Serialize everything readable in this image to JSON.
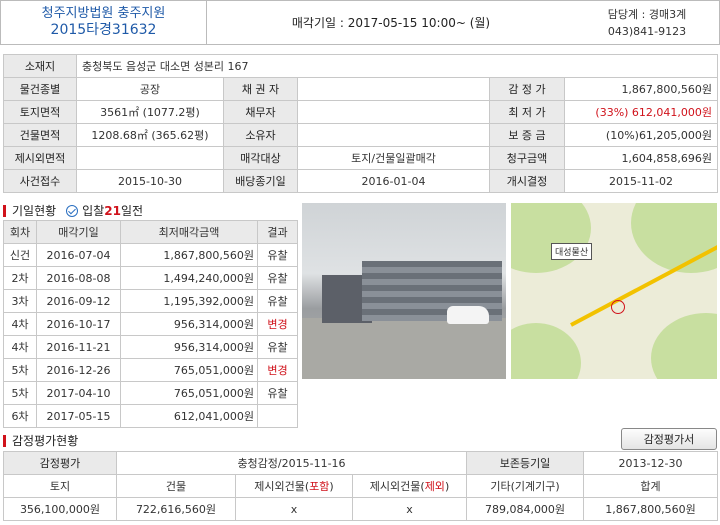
{
  "header": {
    "court": "청주지방법원 충주지원",
    "case_no": "2015타경31632",
    "sale_date": "매각기일 : 2017-05-15  10:00~ (월)",
    "division": "담당계 : 경매3계",
    "phone": "043)841-9123"
  },
  "info": {
    "location_label": "소재지",
    "location": "충청북도 음성군 대소면 성본리 167",
    "rows": [
      [
        "물건종별",
        "공장",
        "채 권 자",
        "",
        "감 정 가",
        "1,867,800,560원"
      ],
      [
        "토지면적",
        "3561㎡ (1077.2평)",
        "채무자",
        "",
        "최 저 가",
        "(33%) 612,041,000원"
      ],
      [
        "건물면적",
        "1208.68㎡ (365.62평)",
        "소유자",
        "",
        "보 증 금",
        "(10%)61,205,000원"
      ],
      [
        "제시외면적",
        "",
        "매각대상",
        "토지/건물일괄매각",
        "청구금액",
        "1,604,858,696원"
      ],
      [
        "사건접수",
        "2015-10-30",
        "배당종기일",
        "2016-01-04",
        "개시결정",
        "2015-11-02"
      ]
    ]
  },
  "history": {
    "title": "기일현황",
    "summary_prefix": "입찰",
    "summary_days": "21",
    "summary_suffix": "일전",
    "headers": [
      "회차",
      "매각기일",
      "최저매각금액",
      "결과"
    ],
    "rows": [
      [
        "신건",
        "2016-07-04",
        "1,867,800,560원",
        "유찰"
      ],
      [
        "2차",
        "2016-08-08",
        "1,494,240,000원",
        "유찰"
      ],
      [
        "3차",
        "2016-09-12",
        "1,195,392,000원",
        "유찰"
      ],
      [
        "4차",
        "2016-10-17",
        "956,314,000원",
        "변경"
      ],
      [
        "4차",
        "2016-11-21",
        "956,314,000원",
        "유찰"
      ],
      [
        "5차",
        "2016-12-26",
        "765,051,000원",
        "변경"
      ],
      [
        "5차",
        "2017-04-10",
        "765,051,000원",
        "유찰"
      ],
      [
        "6차",
        "2017-05-15",
        "612,041,000원",
        ""
      ]
    ]
  },
  "map": {
    "label": "대성물산"
  },
  "appraisal": {
    "title": "감정평가현황",
    "button": "감정평가서",
    "org_label": "감정평가",
    "org_value": "충청감정/2015-11-16",
    "date_label": "보존등기일",
    "date_value": "2013-12-30",
    "headers": [
      "토지",
      "건물",
      "제시외건물(",
      "포함",
      ")",
      "제시외건물(",
      "제외",
      ")",
      "기타(기계기구)",
      "합계"
    ],
    "values": [
      "356,100,000원",
      "722,616,560원",
      "x",
      "x",
      "789,084,000원",
      "1,867,800,560원"
    ]
  },
  "colors": {
    "accent": "#d0121b",
    "title_blue": "#1f5aa8"
  }
}
